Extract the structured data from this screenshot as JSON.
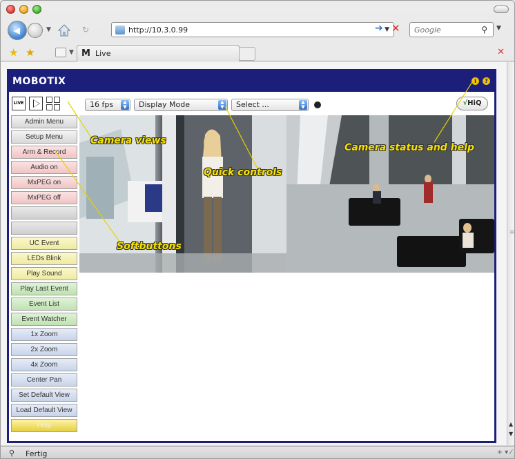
{
  "browser": {
    "url": "http://10.3.0.99",
    "search_placeholder": "Google",
    "tab_title": "Live",
    "tab_logo": "M",
    "status_text": "Fertig"
  },
  "app": {
    "brand": "MOBOTIX",
    "view_buttons": [
      "LIVE",
      "play",
      "multiview"
    ],
    "quick_controls": {
      "fps": "16 fps",
      "display_mode": "Display Mode",
      "select": "Select ..."
    },
    "hiq_label": "HiQ",
    "softbuttons": [
      {
        "label": "Admin Menu",
        "color": "grey"
      },
      {
        "label": "Setup Menu",
        "color": "grey"
      },
      {
        "label": "Arm & Record",
        "color": "pink"
      },
      {
        "label": "Audio on",
        "color": "pink"
      },
      {
        "label": "MxPEG on",
        "color": "pink"
      },
      {
        "label": "MxPEG off",
        "color": "pink"
      },
      {
        "label": "",
        "color": "blank"
      },
      {
        "label": "",
        "color": "blank"
      },
      {
        "label": "UC Event",
        "color": "yellow"
      },
      {
        "label": "LEDs Blink",
        "color": "yellow"
      },
      {
        "label": "Play Sound",
        "color": "yellow"
      },
      {
        "label": "Play Last Event",
        "color": "green"
      },
      {
        "label": "Event List",
        "color": "green"
      },
      {
        "label": "Event Watcher",
        "color": "green"
      },
      {
        "label": "1x Zoom",
        "color": "blue"
      },
      {
        "label": "2x Zoom",
        "color": "blue"
      },
      {
        "label": "4x Zoom",
        "color": "blue"
      },
      {
        "label": "Center Pan",
        "color": "blue"
      },
      {
        "label": "Set Default View",
        "color": "blue"
      },
      {
        "label": "Load Default View",
        "color": "blue"
      },
      {
        "label": "Help",
        "color": "gold"
      }
    ]
  },
  "callouts": {
    "camera_views": "Camera views",
    "quick_controls": "Quick controls",
    "status_help": "Camera status and help",
    "softbuttons": "Softbuttons"
  },
  "colors": {
    "frame": "#1b1f7a",
    "callout": "#f6e000",
    "callout_line": "#f6e000"
  }
}
